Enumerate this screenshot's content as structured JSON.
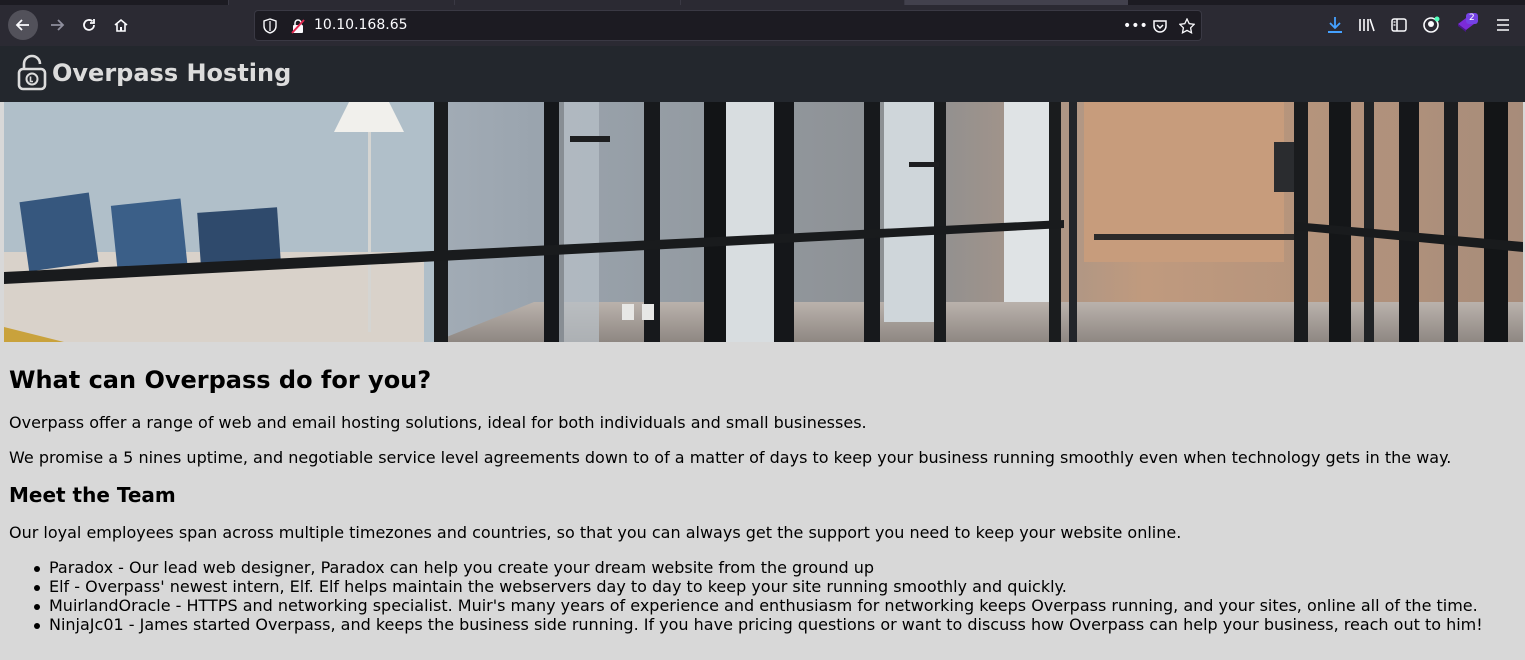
{
  "browser": {
    "url": "10.10.168.65",
    "extension_badge": "2"
  },
  "site": {
    "title": "Overpass Hosting"
  },
  "main": {
    "heading": "What can Overpass do for you?",
    "intro": "Overpass offer a range of web and email hosting solutions, ideal for both individuals and small businesses.",
    "promise": "We promise a 5 nines uptime, and negotiable service level agreements down to of a matter of days to keep your business running smoothly even when technology gets in the way.",
    "team_heading": "Meet the Team",
    "team_intro": "Our loyal employees span across multiple timezones and countries, so that you can always get the support you need to keep your website online.",
    "team": [
      "Paradox - Our lead web designer, Paradox can help you create your dream website from the ground up",
      "Elf - Overpass' newest intern, Elf. Elf helps maintain the webservers day to day to keep your site running smoothly and quickly.",
      "MuirlandOracle - HTTPS and networking specialist. Muir's many years of experience and enthusiasm for networking keeps Overpass running, and your sites, online all of the time.",
      "NinjaJc01 - James started Overpass, and keeps the business side running. If you have pricing questions or want to discuss how Overpass can help your business, reach out to him!"
    ]
  },
  "colors": {
    "page_bg": "#d8d8d8",
    "header_bg": "#23272d",
    "browser_toolbar": "#2b2a33",
    "download_accent": "#45a1ff"
  }
}
